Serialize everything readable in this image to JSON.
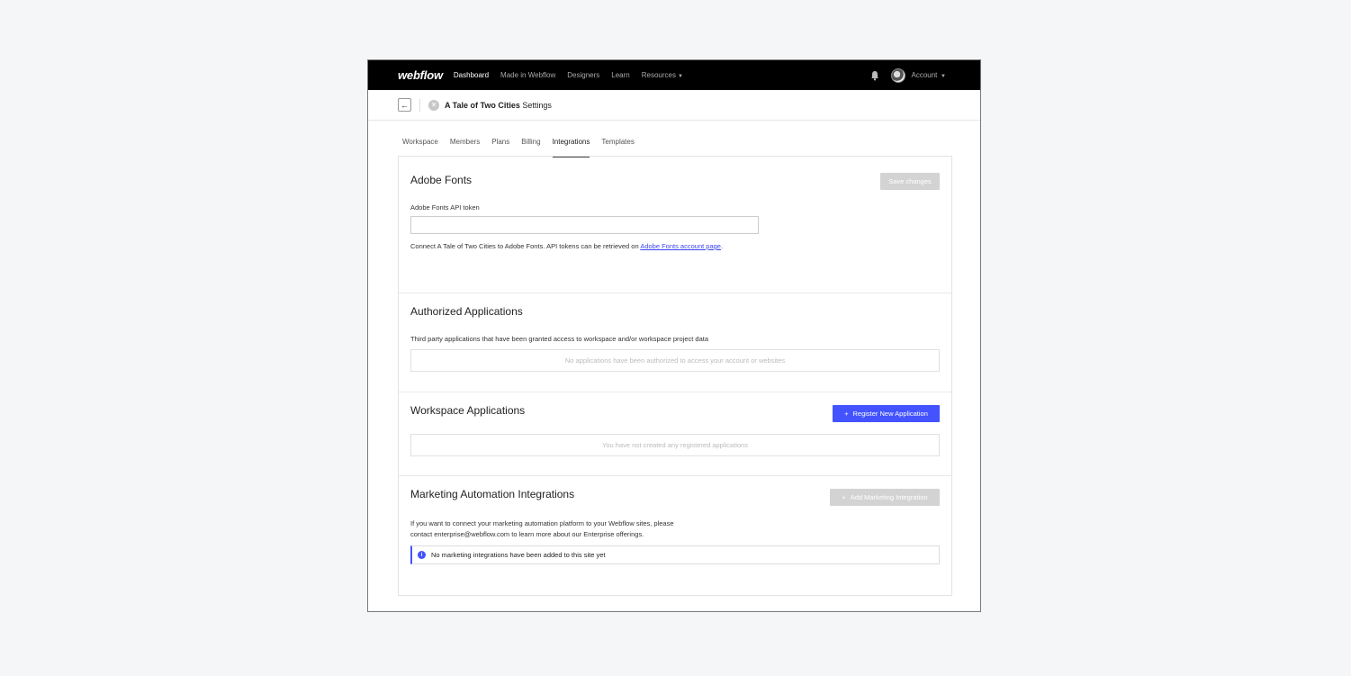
{
  "topnav": {
    "logo": "webflow",
    "links": [
      "Dashboard",
      "Made in Webflow",
      "Designers",
      "Learn"
    ],
    "resources_label": "Resources",
    "account_label": "Account"
  },
  "subheader": {
    "site_name": "A Tale of Two Cities",
    "settings_label": "Settings"
  },
  "tabs": [
    "Workspace",
    "Members",
    "Plans",
    "Billing",
    "Integrations",
    "Templates"
  ],
  "active_tab": "Integrations",
  "adobe": {
    "title": "Adobe Fonts",
    "save_label": "Save changes",
    "field_label": "Adobe Fonts API token",
    "token_value": "",
    "help_text": "Connect A Tale of Two Cities to Adobe Fonts. API tokens can be retrieved on ",
    "help_link": "Adobe Fonts account page",
    "help_end": "."
  },
  "authorized": {
    "title": "Authorized Applications",
    "description": "Third party applications that have been granted access to workspace and/or workspace project data",
    "empty": "No applications have been authorized to access your account or websites"
  },
  "workspace_apps": {
    "title": "Workspace Applications",
    "register_label": "Register New Application",
    "empty": "You have not created any registered applications"
  },
  "marketing": {
    "title": "Marketing Automation Integrations",
    "add_label": "Add Marketing Integration",
    "text_line1": "If you want to connect your marketing automation platform to your Webflow sites, please",
    "text_line2": "contact enterprise@webflow.com to learn more about our Enterprise offerings.",
    "notice": "No marketing integrations have been added to this site yet"
  },
  "colors": {
    "nav_bg": "#000000",
    "accent": "#4353ff",
    "disabled_btn": "#d3d3d3",
    "page_bg": "#f5f6f8"
  }
}
